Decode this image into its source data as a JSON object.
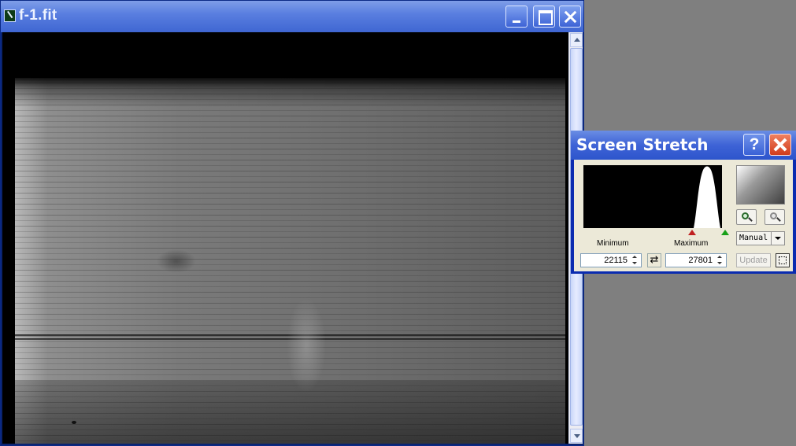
{
  "image_window": {
    "title": "f-1.fit",
    "icon": "app-document-icon",
    "buttons": {
      "minimize": "minimize-icon",
      "maximize": "maximize-icon",
      "close": "close-icon"
    }
  },
  "stretch_dialog": {
    "title": "Screen Stretch",
    "help_label": "?",
    "minimum_label": "Minimum",
    "maximum_label": "Maximum",
    "minimum_value": "22115",
    "maximum_value": "27801",
    "mode_value": "Manual",
    "update_label": "Update",
    "colors": {
      "min_marker": "#c02020",
      "max_marker": "#18a018"
    }
  }
}
